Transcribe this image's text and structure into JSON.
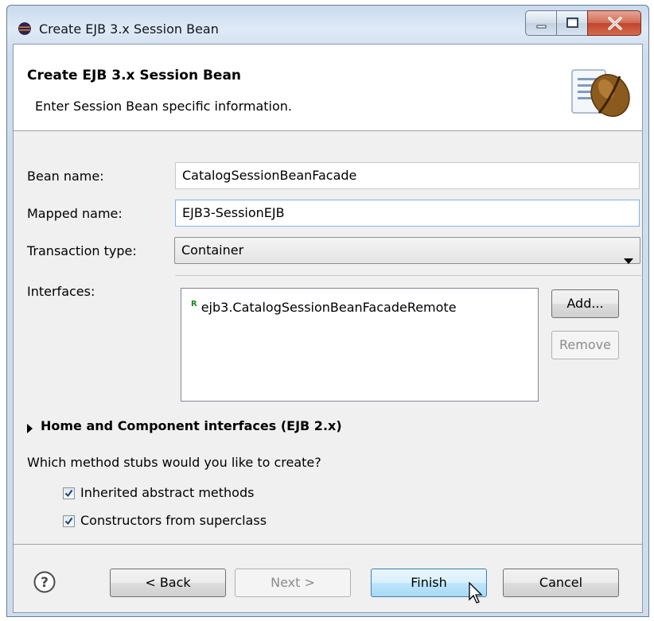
{
  "window": {
    "title": "Create EJB 3.x Session Bean"
  },
  "banner": {
    "title": "Create EJB 3.x Session Bean",
    "description": "Enter Session Bean specific information."
  },
  "form": {
    "bean_name_label": "Bean name:",
    "bean_name_value": "CatalogSessionBeanFacade",
    "mapped_name_label": "Mapped name:",
    "mapped_name_value": "EJB3-SessionEJB",
    "transaction_type_label": "Transaction type:",
    "transaction_type_value": "Container",
    "interfaces_label": "Interfaces:",
    "interfaces": [
      {
        "badge": "R",
        "name": "ejb3.CatalogSessionBeanFacadeRemote"
      }
    ],
    "add_label": "Add...",
    "remove_label": "Remove"
  },
  "home_section": {
    "title": "Home and Component interfaces (EJB 2.x)",
    "expanded": false
  },
  "stubs": {
    "question": "Which method stubs would you like to create?",
    "options": [
      {
        "label": "Inherited abstract methods",
        "checked": true
      },
      {
        "label": "Constructors from superclass",
        "checked": true
      }
    ]
  },
  "buttons": {
    "back": "< Back",
    "next": "Next >",
    "finish": "Finish",
    "cancel": "Cancel"
  },
  "icons": {
    "title": "eclipse-icon",
    "banner": "coffee-bean-icon",
    "help": "help-icon"
  },
  "colors": {
    "title_bar": "#dfeaf6",
    "close_button": "#c2442a",
    "default_button": "#bee6fd",
    "dialog_bg": "#f0f0f0"
  }
}
